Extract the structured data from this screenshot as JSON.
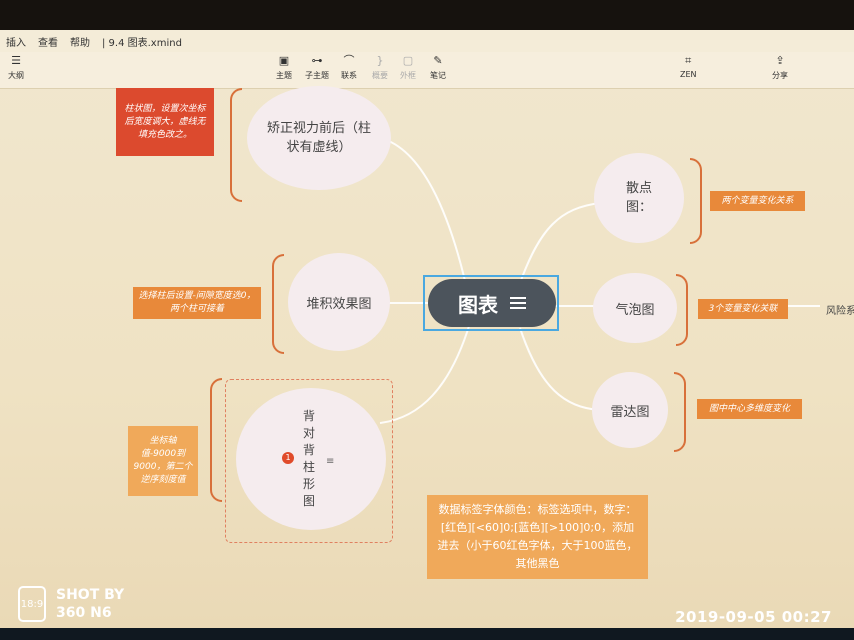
{
  "menubar": {
    "items": [
      "插入",
      "查看",
      "帮助"
    ],
    "file_title": "| 9.4 图表.xmind"
  },
  "toolbar": {
    "outline": "大纲",
    "topic": "主题",
    "subtopic": "子主题",
    "relation": "联系",
    "summary": "概要",
    "boundary": "外框",
    "note": "笔记",
    "zen": "ZEN",
    "share": "分享"
  },
  "mindmap": {
    "central": "图表",
    "left_nodes": [
      {
        "label": "矫正视力前后（柱状有虚线）",
        "note": "柱状图，设置次坐标后宽度调大，虚线无填充色改之。"
      },
      {
        "label": "堆积效果图",
        "note": "选择柱后设置-间隙宽度选0，两个柱可接着"
      },
      {
        "label": "背对背柱形图",
        "note": "坐标轴值-9000到9000，第二个逆序刻度值",
        "badge": "1"
      }
    ],
    "right_nodes": [
      {
        "label": "散点图：",
        "note": "两个变量变化关系"
      },
      {
        "label": "气泡图",
        "note": "3个变量变化关联",
        "extra": "风险系"
      },
      {
        "label": "雷达图",
        "note": "图中中心多维度变化"
      }
    ],
    "floating_note": "数据标签字体颜色：标签选项中，数字：[红色][<60]0;[蓝色][>100]0;0，添加进去（小于60红色字体，大于100蓝色，其他黑色"
  },
  "overlay": {
    "watermark_line1": "SHOT BY",
    "watermark_line2": "360 N6",
    "ratio": "18:9",
    "datetime": "2019-09-05  00:27"
  },
  "colors": {
    "note_red": "#dc4a2e",
    "note_orange": "#e8893a",
    "note_light": "#f0a95a",
    "central": "#4c545c",
    "selection": "#4aa8e0"
  }
}
